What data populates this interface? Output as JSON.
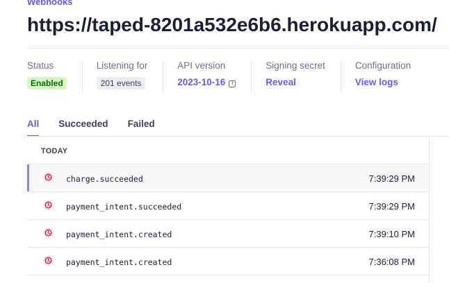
{
  "breadcrumb": "Webhooks",
  "title": "https://taped-8201a532e6b6.herokuapp.com/",
  "meta": {
    "status_label": "Status",
    "status_value": "Enabled",
    "listening_label": "Listening for",
    "listening_value": "201 events",
    "api_label": "API version",
    "api_value": "2023-10-16",
    "secret_label": "Signing secret",
    "secret_value": "Reveal",
    "config_label": "Configuration",
    "config_value": "View logs"
  },
  "tabs": [
    {
      "label": "All"
    },
    {
      "label": "Succeeded"
    },
    {
      "label": "Failed"
    }
  ],
  "group_label": "TODAY",
  "events": [
    {
      "name": "charge.succeeded",
      "time": "7:39:29 PM"
    },
    {
      "name": "payment_intent.succeeded",
      "time": "7:39:29 PM"
    },
    {
      "name": "payment_intent.created",
      "time": "7:39:10 PM"
    },
    {
      "name": "payment_intent.created",
      "time": "7:36:08 PM"
    }
  ],
  "colors": {
    "accent": "#635bff",
    "enabled_bg": "#d7f7c2",
    "enabled_text": "#05690d",
    "event_icon": "#df1b41"
  },
  "icons": {
    "event_status": "clock-icon",
    "api_info": "info-icon"
  }
}
